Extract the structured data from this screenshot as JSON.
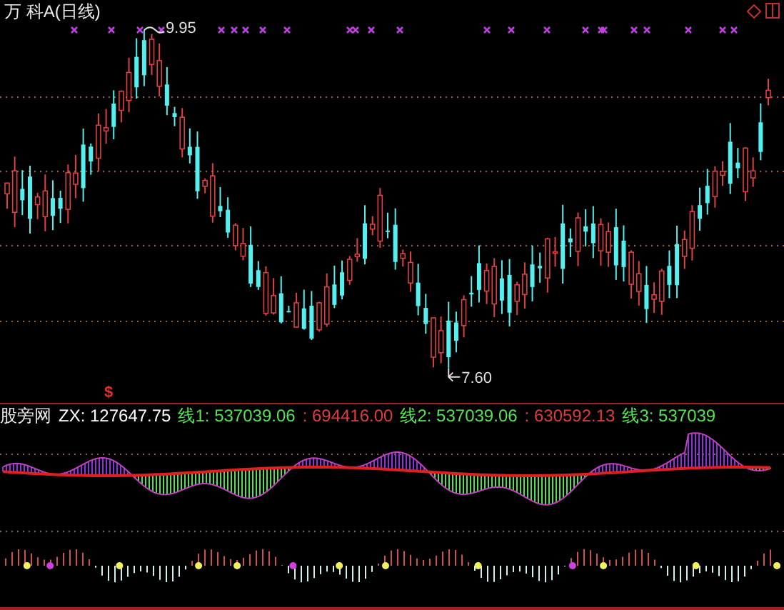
{
  "chart_title": "万 科A(日线)",
  "main_chart": {
    "high_label": "9.95",
    "low_label": "7.60",
    "signal_mark": "$"
  },
  "indicator": {
    "name": "股旁网",
    "readings": [
      {
        "text": "ZX: 127647.75",
        "color": "#ffffff"
      },
      {
        "text": "线1: 537039.06",
        "color": "#54e354"
      },
      {
        "text": ": 694416.00",
        "color": "#e03c3c"
      },
      {
        "text": "线2: 537039.06",
        "color": "#54e354"
      },
      {
        "text": ": 630592.13",
        "color": "#e03c3c"
      },
      {
        "text": "线3: 537039",
        "color": "#54e354"
      }
    ]
  }
}
